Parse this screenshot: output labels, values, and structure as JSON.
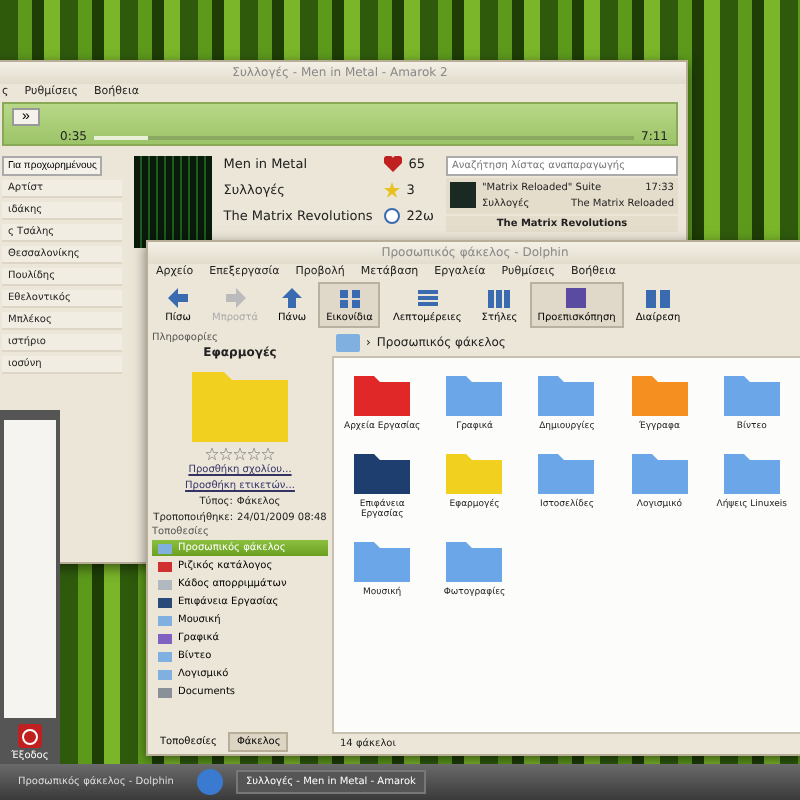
{
  "amarok": {
    "title": "Συλλογές - Men in Metal - Amarok 2",
    "menu": [
      "ς",
      "Ρυθμίσεις",
      "Βοήθεια"
    ],
    "next_button": "»",
    "elapsed": "0:35",
    "remaining": "7:11",
    "progress": {
      "level": 0.1
    },
    "filter_button": "Για προχωρημένους",
    "collection": [
      "Αρτίστ",
      "ιδάκης",
      "ς Τσάλης",
      "Θεσσαλονίκης",
      "Πουλίδης",
      "Εθελοντικός",
      "Μπλέκος",
      "ιστήριο",
      "ιοσύνη"
    ],
    "now_playing": {
      "title": "Men in Metal",
      "artist": "Συλλογές",
      "album": "The Matrix Revolutions",
      "score": "65",
      "rating": "3",
      "length": "22ω"
    },
    "playlist_search": {
      "placeholder": "Αναζήτηση λίστας αναπαραγωγής"
    },
    "playlist": [
      {
        "title": "\"Matrix Reloaded\" Suite",
        "time": "17:33",
        "artist": "Συλλογές",
        "album": "The Matrix Reloaded"
      },
      {
        "title": "The Matrix Revolutions"
      }
    ]
  },
  "launcher": {
    "exit_label": "Έξοδος"
  },
  "dolphin": {
    "title": "Προσωπικός φάκελος - Dolphin",
    "menu": [
      "Αρχείο",
      "Επεξεργασία",
      "Προβολή",
      "Μετάβαση",
      "Εργαλεία",
      "Ρυθμίσεις",
      "Βοήθεια"
    ],
    "toolbar": [
      {
        "label": "Πίσω",
        "kind": "left",
        "selected": false,
        "disabled": false
      },
      {
        "label": "Μπροστά",
        "kind": "right",
        "selected": false,
        "disabled": true
      },
      {
        "label": "Πάνω",
        "kind": "up",
        "selected": false,
        "disabled": false
      },
      {
        "label": "Εικονίδια",
        "kind": "icons",
        "selected": true,
        "disabled": false
      },
      {
        "label": "Λεπτομέρειες",
        "kind": "details",
        "selected": false,
        "disabled": false
      },
      {
        "label": "Στήλες",
        "kind": "columns",
        "selected": false,
        "disabled": false
      },
      {
        "label": "Προεπισκόπηση",
        "kind": "preview",
        "selected": true,
        "disabled": false
      },
      {
        "label": "Διαίρεση",
        "kind": "split",
        "selected": false,
        "disabled": false
      }
    ],
    "info_panel": {
      "title": "Πληροφορίες",
      "name": "Εφαρμογές",
      "stars": 0,
      "links": [
        "Προσθήκη σχολίου...",
        "Προσθήκη ετικετών..."
      ],
      "type_label": "Τύπος:",
      "type_value": "Φάκελος",
      "modified_label": "Τροποποιήθηκε:",
      "modified_value": "24/01/2009 08:48"
    },
    "places_title": "Τοποθεσίες",
    "places": [
      {
        "label": "Προσωπικός φάκελος",
        "selected": true,
        "color": "#7fb0e0"
      },
      {
        "label": "Ριζικός κατάλογος",
        "selected": false,
        "color": "#d03030"
      },
      {
        "label": "Κάδος απορριμμάτων",
        "selected": false,
        "color": "#b0b8c0"
      },
      {
        "label": "Επιφάνεια Εργασίας",
        "selected": false,
        "color": "#2a4a78"
      },
      {
        "label": "Μουσική",
        "selected": false,
        "color": "#7fb0e0"
      },
      {
        "label": "Γραφικά",
        "selected": false,
        "color": "#8060c0"
      },
      {
        "label": "Βίντεο",
        "selected": false,
        "color": "#7fb0e0"
      },
      {
        "label": "Λογισμικό",
        "selected": false,
        "color": "#7fb0e0"
      },
      {
        "label": "Documents",
        "selected": false,
        "color": "#8a9098"
      }
    ],
    "panel_tabs": [
      {
        "label": "Τοποθεσίες",
        "selected": false
      },
      {
        "label": "Φάκελος",
        "selected": true
      }
    ],
    "breadcrumb_separator": "›",
    "breadcrumb": "Προσωπικός φάκελος",
    "files": [
      {
        "name": "Αρχεία Εργασίας",
        "color": "#e02828"
      },
      {
        "name": "Γραφικά",
        "color": "#6aa6e8"
      },
      {
        "name": "Δημιουργίες",
        "color": "#6aa6e8"
      },
      {
        "name": "Έγγραφα",
        "color": "#f59020"
      },
      {
        "name": "Βίντεο",
        "color": "#6aa6e8"
      },
      {
        "name": "Επιφάνεια Εργασίας",
        "color": "#1e3e70"
      },
      {
        "name": "Εφαρμογές",
        "color": "#f2d020"
      },
      {
        "name": "Ιστοσελίδες",
        "color": "#6aa6e8"
      },
      {
        "name": "Λογισμικό",
        "color": "#6aa6e8"
      },
      {
        "name": "Λήψεις Linuxeis",
        "color": "#6aa6e8"
      },
      {
        "name": "Μουσική",
        "color": "#6aa6e8"
      },
      {
        "name": "Φωτογραφίες",
        "color": "#6aa6e8"
      }
    ],
    "status": "14 φάκελοι"
  },
  "taskbar": [
    {
      "label": "Προσωπικός φάκελος - Dolphin",
      "selected": false
    },
    {
      "label": "Συλλογές - Men in Metal - Amarok",
      "selected": true
    }
  ]
}
